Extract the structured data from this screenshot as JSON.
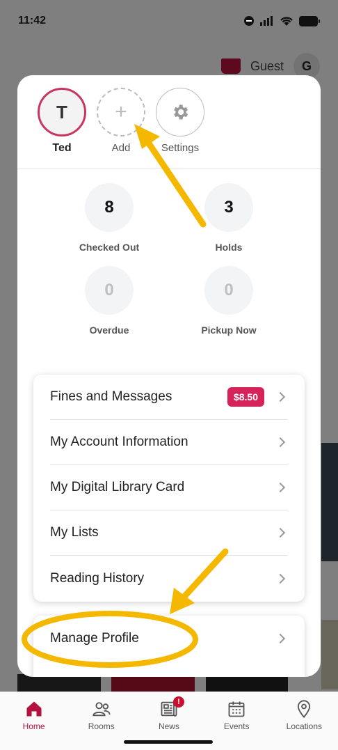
{
  "status": {
    "time": "11:42"
  },
  "header": {
    "guest_label": "Guest",
    "avatar_initial": "G"
  },
  "profiles": {
    "ted": {
      "initial": "T",
      "name": "Ted"
    },
    "add": {
      "symbol": "+",
      "label": "Add"
    },
    "settings": {
      "label": "Settings"
    }
  },
  "stats": {
    "checked_out": {
      "value": "8",
      "label": "Checked Out"
    },
    "holds": {
      "value": "3",
      "label": "Holds"
    },
    "overdue": {
      "value": "0",
      "label": "Overdue"
    },
    "pickup_now": {
      "value": "0",
      "label": "Pickup Now"
    }
  },
  "menu": {
    "fines": {
      "label": "Fines and Messages",
      "badge": "$8.50"
    },
    "account": {
      "label": "My Account Information"
    },
    "card": {
      "label": "My Digital Library Card"
    },
    "lists": {
      "label": "My Lists"
    },
    "history": {
      "label": "Reading History"
    },
    "manage": {
      "label": "Manage Profile"
    }
  },
  "tabs": [
    {
      "label": "Home",
      "icon": "home-icon",
      "active": true
    },
    {
      "label": "Rooms",
      "icon": "people-icon"
    },
    {
      "label": "News",
      "icon": "newspaper-icon",
      "badge": "!"
    },
    {
      "label": "Events",
      "icon": "calendar-icon"
    },
    {
      "label": "Locations",
      "icon": "location-pin-icon"
    }
  ],
  "colors": {
    "brand": "#b3123e",
    "badge": "#d6245a",
    "annotation": "#f5b800"
  }
}
